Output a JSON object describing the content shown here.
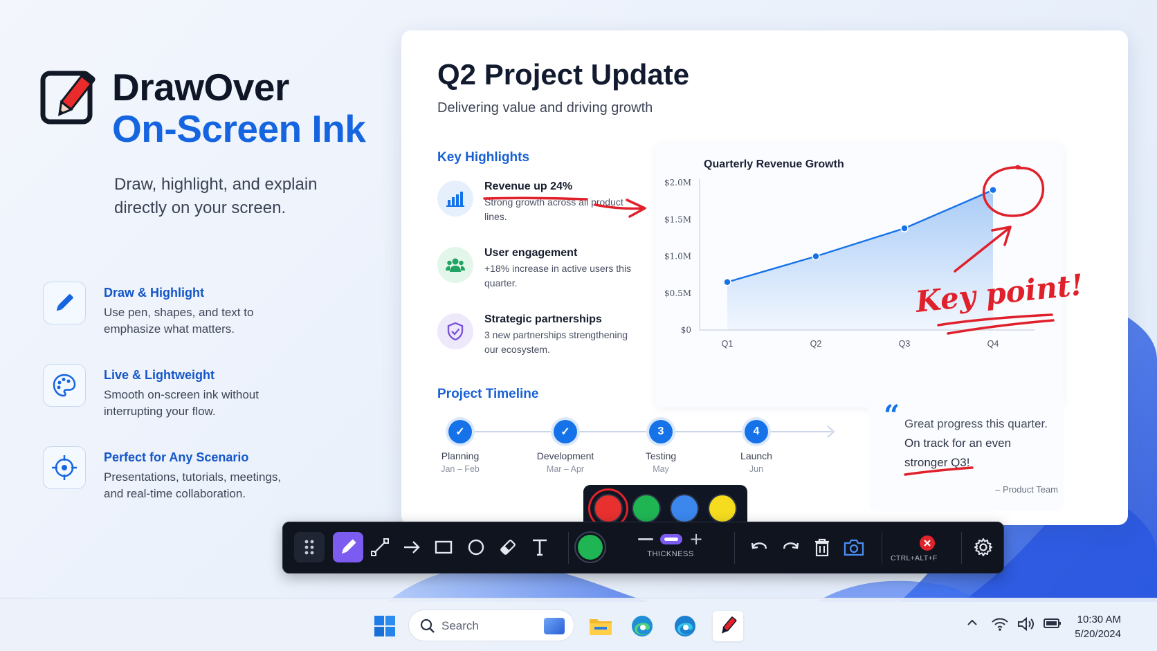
{
  "brand": {
    "name": "DrawOver",
    "subtitle": "On-Screen Ink",
    "tagline": "Draw, highlight, and explain directly on your screen."
  },
  "features": [
    {
      "title": "Draw & Highlight",
      "desc": "Use pen, shapes, and text to emphasize what matters.",
      "icon": "pencil-icon"
    },
    {
      "title": "Live & Lightweight",
      "desc": "Smooth on-screen ink without interrupting your flow.",
      "icon": "palette-icon"
    },
    {
      "title": "Perfect for Any Scenario",
      "desc": "Presentations, tutorials, meetings, and real-time collaboration.",
      "icon": "crosshair-icon"
    }
  ],
  "slide": {
    "title": "Q2 Project Update",
    "subtitle": "Delivering value and driving growth",
    "highlights_heading": "Key Highlights",
    "highlights": [
      {
        "title": "Revenue up 24%",
        "desc": "Strong growth across all product lines.",
        "icon": "bar-chart-icon",
        "color": "#1572e8"
      },
      {
        "title": "User engagement",
        "desc": "+18% increase in active users this quarter.",
        "icon": "users-icon",
        "color": "#1fa463"
      },
      {
        "title": "Strategic partnerships",
        "desc": "3 new partnerships strengthening our ecosystem.",
        "icon": "shield-icon",
        "color": "#7a55d8"
      }
    ],
    "timeline_heading": "Project Timeline",
    "timeline": [
      {
        "name": "Planning",
        "date": "Jan – Feb",
        "marker": "✓"
      },
      {
        "name": "Development",
        "date": "Mar – Apr",
        "marker": "✓"
      },
      {
        "name": "Testing",
        "date": "May",
        "marker": "3"
      },
      {
        "name": "Launch",
        "date": "Jun",
        "marker": "4"
      }
    ],
    "quote": {
      "line1": "Great progress this quarter.",
      "line2": "On track for an even stronger Q3!",
      "author": "– Product Team"
    }
  },
  "chart_data": {
    "type": "area",
    "title": "Quarterly Revenue Growth",
    "categories": [
      "Q1",
      "Q2",
      "Q3",
      "Q4"
    ],
    "series": [
      {
        "values": [
          0.65,
          1.0,
          1.38,
          1.9
        ]
      }
    ],
    "ylim": [
      0,
      2.0
    ],
    "yticks": [
      "$0",
      "$0.5M",
      "$1.0M",
      "$1.5M",
      "$2.0M"
    ],
    "ytick_values": [
      0,
      0.5,
      1.0,
      1.5,
      2.0
    ],
    "grid": false,
    "annotation": "Key point!"
  },
  "annotation_colors": {
    "ink": "#e0202a",
    "accent": "#1572e8"
  },
  "palette": {
    "colors": [
      "#e8302f",
      "#1fb553",
      "#3b87ee",
      "#f5dc1f"
    ],
    "selected": 0
  },
  "toolbar": {
    "tools": [
      "grip-icon",
      "pen-icon",
      "line-icon",
      "arrow-icon",
      "rectangle-icon",
      "ellipse-icon",
      "eraser-icon",
      "text-icon"
    ],
    "active_tool": "pen-icon",
    "current_color": "#1fb553",
    "thickness_label": "THICKNESS",
    "hotkey_label": "CTRL+ALT+F"
  },
  "taskbar": {
    "search_placeholder": "Search",
    "time": "10:30 AM",
    "date": "5/20/2024"
  }
}
